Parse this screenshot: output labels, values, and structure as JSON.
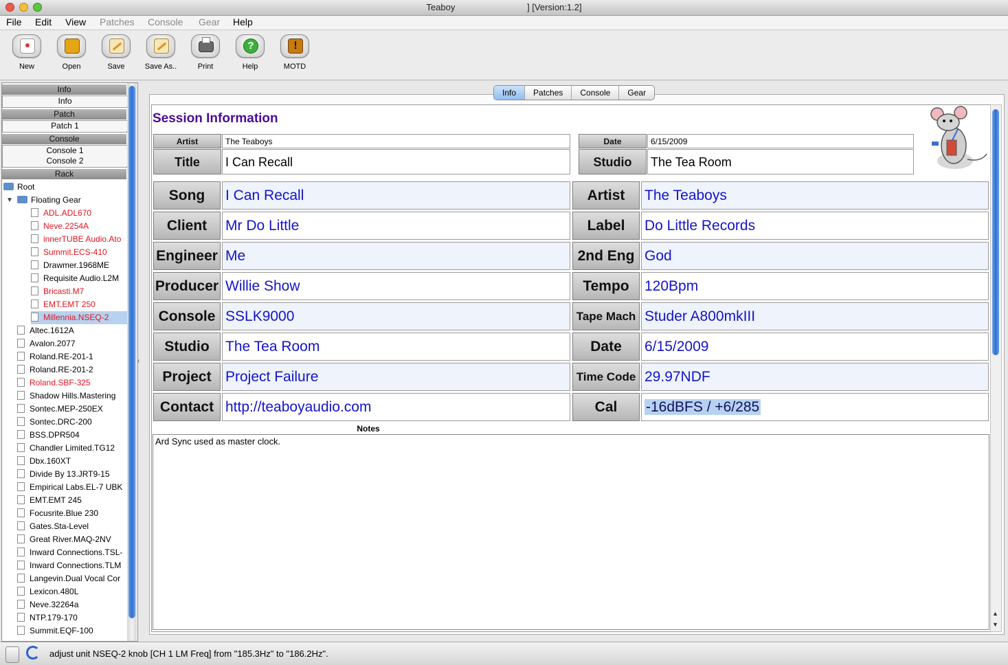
{
  "window": {
    "title": "Teaboy                             ] [Version:1.2]"
  },
  "menu": [
    {
      "label": "File",
      "enabled": true
    },
    {
      "label": "Edit",
      "enabled": true
    },
    {
      "label": "View",
      "enabled": true
    },
    {
      "label": "Patches",
      "enabled": false
    },
    {
      "label": "Console",
      "enabled": false
    },
    {
      "label": "Gear",
      "enabled": false
    },
    {
      "label": "Help",
      "enabled": true
    }
  ],
  "toolbar": [
    {
      "label": "New",
      "icon": "new-document-icon",
      "color": "#d23a3a"
    },
    {
      "label": "Open",
      "icon": "open-folder-icon",
      "color": "#e6a516"
    },
    {
      "label": "Save",
      "icon": "save-pencil-icon",
      "color": "#e8c468"
    },
    {
      "label": "Save As..",
      "icon": "save-as-pencil-icon",
      "color": "#e8b468"
    },
    {
      "label": "Print",
      "icon": "printer-icon",
      "color": "#555555"
    },
    {
      "label": "Help",
      "icon": "help-question-icon",
      "color": "#35a335"
    },
    {
      "label": "MOTD",
      "icon": "motd-exclamation-icon",
      "color": "#c77a10"
    }
  ],
  "sidebar": {
    "sections": {
      "info_header": "Info",
      "info_item": "Info",
      "patch_header": "Patch",
      "patch_item": "Patch 1",
      "console_header": "Console",
      "console_items": [
        "Console 1",
        "Console 2"
      ],
      "rack_header": "Rack"
    },
    "tree": {
      "root": "Root",
      "floating": "Floating Gear",
      "floating_items": [
        {
          "label": "ADL.ADL670",
          "red": true
        },
        {
          "label": "Neve.2254A",
          "red": true
        },
        {
          "label": "innerTUBE Audio.Ato",
          "red": true
        },
        {
          "label": "Summit.ECS-410",
          "red": true
        },
        {
          "label": "Drawmer.1968ME",
          "red": false
        },
        {
          "label": "Requisite Audio.L2M",
          "red": false
        },
        {
          "label": "Bricasti.M7",
          "red": true
        },
        {
          "label": "EMT.EMT 250",
          "red": true
        },
        {
          "label": "Millennia.NSEQ-2",
          "red": true,
          "selected": true
        }
      ],
      "root_items": [
        {
          "label": "Altec.1612A",
          "red": false
        },
        {
          "label": "Avalon.2077",
          "red": false
        },
        {
          "label": "Roland.RE-201-1",
          "red": false
        },
        {
          "label": "Roland.RE-201-2",
          "red": false
        },
        {
          "label": "Roland.SBF-325",
          "red": true
        },
        {
          "label": "Shadow Hills.Mastering",
          "red": false
        },
        {
          "label": "Sontec.MEP-250EX",
          "red": false
        },
        {
          "label": "Sontec.DRC-200",
          "red": false
        },
        {
          "label": "BSS.DPR504",
          "red": false
        },
        {
          "label": "Chandler Limited.TG12",
          "red": false
        },
        {
          "label": "Dbx.160XT",
          "red": false
        },
        {
          "label": "Divide By 13.JRT9-15",
          "red": false
        },
        {
          "label": "Empirical Labs.EL-7 UBK",
          "red": false
        },
        {
          "label": "EMT.EMT 245",
          "red": false
        },
        {
          "label": "Focusrite.Blue 230",
          "red": false
        },
        {
          "label": "Gates.Sta-Level",
          "red": false
        },
        {
          "label": "Great River.MAQ-2NV",
          "red": false
        },
        {
          "label": "Inward Connections.TSL-",
          "red": false
        },
        {
          "label": "Inward Connections.TLM",
          "red": false
        },
        {
          "label": "Langevin.Dual Vocal Cor",
          "red": false
        },
        {
          "label": "Lexicon.480L",
          "red": false
        },
        {
          "label": "Neve.32264a",
          "red": false
        },
        {
          "label": "NTP.179-170",
          "red": false
        },
        {
          "label": "Summit.EQF-100",
          "red": false
        }
      ]
    }
  },
  "tabs": [
    "Info",
    "Patches",
    "Console",
    "Gear"
  ],
  "active_tab": "Info",
  "session": {
    "heading": "Session Information",
    "top": {
      "artist_label": "Artist",
      "artist": "The Teaboys",
      "title_label": "Title",
      "title": "I Can Recall",
      "date_label": "Date",
      "date": "6/15/2009",
      "studio_label": "Studio",
      "studio": "The Tea Room"
    },
    "rows": [
      {
        "l_label": "Song",
        "l_value": "I Can Recall",
        "r_label": "Artist",
        "r_value": "The Teaboys"
      },
      {
        "l_label": "Client",
        "l_value": "Mr Do Little",
        "r_label": "Label",
        "r_value": "Do Little Records"
      },
      {
        "l_label": "Engineer",
        "l_value": "Me",
        "r_label": "2nd Eng",
        "r_value": "God"
      },
      {
        "l_label": "Producer",
        "l_value": "Willie Show",
        "r_label": "Tempo",
        "r_value": "120Bpm"
      },
      {
        "l_label": "Console",
        "l_value": "SSLK9000",
        "r_label": "Tape Mach",
        "r_value": "Studer A800mkIII"
      },
      {
        "l_label": "Studio",
        "l_value": "The Tea Room",
        "r_label": "Date",
        "r_value": "6/15/2009"
      },
      {
        "l_label": "Project",
        "l_value": "Project Failure",
        "r_label": "Time Code",
        "r_value": "29.97NDF"
      },
      {
        "l_label": "Contact",
        "l_value": "http://teaboyaudio.com",
        "r_label": "Cal",
        "r_value": "-16dBFS / +6/285"
      }
    ],
    "notes_label": "Notes",
    "notes": "Ard Sync used as master clock."
  },
  "status": {
    "message": "adjust unit NSEQ-2 knob [CH 1 LM Freq] from \"185.3Hz\" to \"186.2Hz\"."
  }
}
